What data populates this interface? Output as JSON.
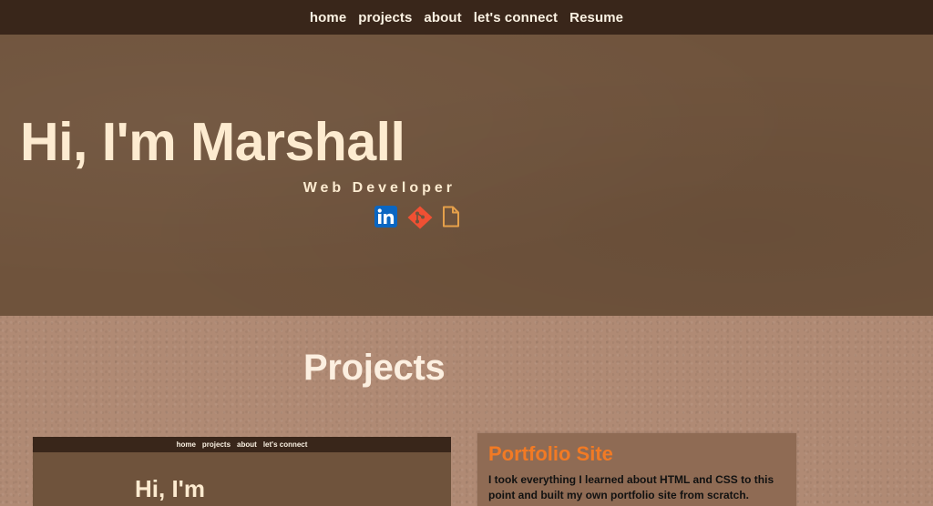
{
  "nav": {
    "items": [
      {
        "label": "home"
      },
      {
        "label": "projects"
      },
      {
        "label": "about"
      },
      {
        "label": "let's connect"
      },
      {
        "label": "Resume"
      }
    ]
  },
  "hero": {
    "title": "Hi, I'm Marshall",
    "subtitle": "Web Developer",
    "icons": [
      {
        "name": "linkedin-icon",
        "color": "#0a66c2"
      },
      {
        "name": "git-icon",
        "color": "#f05033"
      },
      {
        "name": "resume-file-icon",
        "color": "#e6a04a"
      }
    ]
  },
  "projects": {
    "heading": "Projects",
    "items": [
      {
        "preview": {
          "nav": [
            "home",
            "projects",
            "about",
            "let's connect"
          ],
          "title": "Hi, I'm"
        },
        "title": "Portfolio Site",
        "description": "I took everything I learned about HTML and CSS to this point and built my own portfolio site from scratch."
      }
    ]
  },
  "colors": {
    "nav_bg": "#39261a",
    "hero_bg": "#6f533c",
    "section_bg": "#b08a74",
    "accent": "#f27a24",
    "text_light": "#fdebd0"
  }
}
